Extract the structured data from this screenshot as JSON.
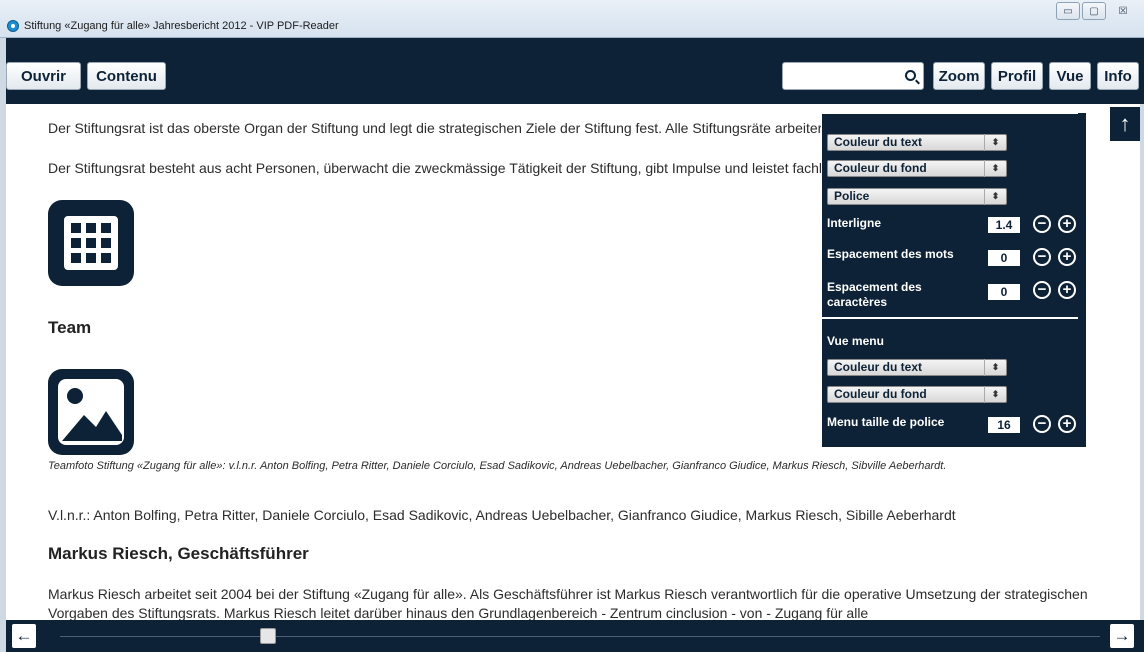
{
  "window": {
    "title": "Stiftung «Zugang für alle» Jahresbericht 2012 - VIP PDF-Reader",
    "minimize": "▭",
    "maximize": "▢",
    "close": "☒"
  },
  "toolbar": {
    "open_label": "Ouvrir",
    "contents_label": "Contenu",
    "search_placeholder": "",
    "search_value": "",
    "zoom_label": "Zoom",
    "profile_label": "Profil",
    "view_label": "Vue",
    "info_label": "Info"
  },
  "document": {
    "para1": "Der Stiftungsrat ist das oberste Organ der Stiftung und legt die strategischen Ziele der Stiftung fest. Alle Stiftungsräte arbeiter",
    "para2": "Der Stiftungsrat besteht aus acht Personen, überwacht die zweckmässige Tätigkeit der Stiftung, gibt Impulse und leistet fachl",
    "team_heading": "Team",
    "caption": "Teamfoto Stiftung «Zugang für alle»: v.l.n.r. Anton Bolfing, Petra Ritter, Daniele Corciulo, Esad Sadikovic, Andreas Uebelbacher, Gianfranco Giudice, Markus Riesch, Sibville Aeberhardt.",
    "vlnr": "V.l.n.r.: Anton Bolfing, Petra Ritter, Daniele Corciulo, Esad Sadikovic, Andreas Uebelbacher, Gianfranco Giudice, Markus Riesch, Sibille Aeberhardt",
    "ceo_heading": "Markus Riesch, Geschäftsführer",
    "ceo_para": "Markus Riesch arbeitet seit 2004 bei der Stiftung «Zugang für alle». Als Geschäftsführer ist Markus Riesch verantwortlich für die operative Umsetzung der strategischen",
    "ceo_para_cut": "Vorgaben des Stiftungsrats. Markus Riesch leitet darüber hinaus den Grundlagenbereich - Zentrum cinclusion - von - Zugang für alle"
  },
  "settings": {
    "text_color": "Couleur du text",
    "bg_color": "Couleur du fond",
    "font": "Police",
    "line_spacing_label": "Interligne",
    "line_spacing_value": "1.4",
    "word_spacing_label": "Espacement des mots",
    "word_spacing_value": "0",
    "char_spacing_label": "Espacement des caractères",
    "char_spacing_value": "0",
    "view_menu_label": "Vue menu",
    "menu_text_color": "Couleur du text",
    "menu_bg_color": "Couleur du fond",
    "menu_font_size_label": "Menu taille de police",
    "menu_font_size_value": "16",
    "select_arrow": "⬍",
    "minus": "−",
    "plus": "+"
  },
  "navigation": {
    "scroll_up": "↑",
    "prev": "←",
    "next": "→",
    "page_position_fraction": 0.2
  },
  "colors": {
    "accent": "#0d2236",
    "background": "#ffffff"
  }
}
